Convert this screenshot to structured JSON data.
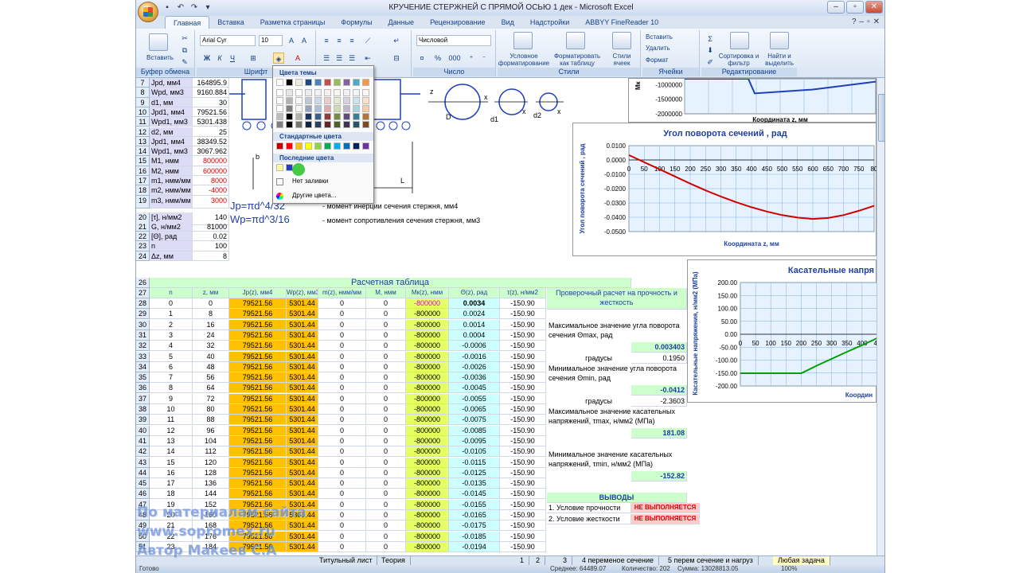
{
  "window": {
    "title": "КРУЧЕНИЕ СТЕРЖНЕЙ С ПРЯМОЙ ОСЬЮ 1 дек - Microsoft Excel"
  },
  "ribbon": {
    "tabs": [
      "Главная",
      "Вставка",
      "Разметка страницы",
      "Формулы",
      "Данные",
      "Рецензирование",
      "Вид",
      "Надстройки",
      "ABBYY FineReader 10"
    ],
    "clipboard": {
      "paste": "Вставить",
      "label": "Буфер обмена"
    },
    "font": {
      "name": "Arial Cyr",
      "size": "10",
      "label": "Шрифт",
      "bold": "Ж",
      "italic": "К",
      "underline": "Ч"
    },
    "number": {
      "format": "Числовой",
      "label": "Число",
      "percent": "%",
      "thousands": "000"
    },
    "styles": {
      "cond": "Условное форматирование",
      "table": "Форматировать как таблицу",
      "cell": "Стили ячеек",
      "label": "Стили"
    },
    "cells": {
      "insert": "Вставить",
      "delete": "Удалить",
      "format": "Формат",
      "label": "Ячейки"
    },
    "editing": {
      "sum": "Σ",
      "sort": "Сортировка и фильтр",
      "find": "Найти и выделить",
      "label": "Редактирование"
    }
  },
  "colorpop": {
    "theme_header": "Цвета темы",
    "standard_header": "Стандартные цвета",
    "recent_header": "Последние цвета",
    "no_fill": "Нет заливки",
    "more_colors": "Другие цвета...",
    "theme_top": [
      "#ffffff",
      "#000000",
      "#eeece1",
      "#1f497d",
      "#4f81bd",
      "#c0504d",
      "#9bbb59",
      "#8064a2",
      "#4bacc6",
      "#f79646"
    ],
    "standard": [
      "#c00000",
      "#ff0000",
      "#ffc000",
      "#ffff00",
      "#92d050",
      "#00b050",
      "#00b0f0",
      "#0070c0",
      "#002060",
      "#7030a0"
    ],
    "recent": [
      "#ffff99",
      "#1f3fbf"
    ]
  },
  "params": [
    {
      "row": "7",
      "name": "Jpd, мм4",
      "value": "164895.9"
    },
    {
      "row": "8",
      "name": "Wpd, мм3",
      "value": "9160.884"
    },
    {
      "row": "9",
      "name": "d1, мм",
      "value": "30"
    },
    {
      "row": "10",
      "name": "Jpd1, мм4",
      "value": "79521.56"
    },
    {
      "row": "11",
      "name": "Wpd1, мм3",
      "value": "5301.438"
    },
    {
      "row": "12",
      "name": "d2, мм",
      "value": "25"
    },
    {
      "row": "13",
      "name": "Jpd1, мм4",
      "value": "38349.52"
    },
    {
      "row": "14",
      "name": "Wpd1, мм3",
      "value": "3067.962"
    },
    {
      "row": "15",
      "name": "M1, нмм",
      "value": "800000"
    },
    {
      "row": "16",
      "name": "M2, нмм",
      "value": "600000"
    },
    {
      "row": "17",
      "name": "m1, нмм/мм",
      "value": "8000"
    },
    {
      "row": "18",
      "name": "m2, нмм/мм",
      "value": "-4000"
    },
    {
      "row": "19",
      "name": "m3, нмм/мм",
      "value": "3000"
    },
    {
      "row": "20",
      "name": "[τ], н/мм2",
      "value": "140"
    },
    {
      "row": "21",
      "name": "G, н/мм2",
      "value": "81000"
    },
    {
      "row": "22",
      "name": "[Θ], рад",
      "value": "0.02"
    },
    {
      "row": "23",
      "name": "n",
      "value": "100"
    },
    {
      "row": "24",
      "name": "Δz, мм",
      "value": "8"
    }
  ],
  "formulas": {
    "jp": "Jp=πd^4/32",
    "jp_desc": "- момент инерции сечения стержня, мм4",
    "wp": "Wp=πd^3/16",
    "wp_desc": "- момент сопротивления сечения стержня, мм3"
  },
  "diagram": {
    "labels": [
      "z",
      "D",
      "x",
      "d1",
      "x",
      "d2",
      "x",
      "L",
      "b"
    ]
  },
  "table": {
    "title": "Расчетная таблица",
    "title_row": "26",
    "header_row": "27",
    "headers": [
      "n",
      "z, мм",
      "Jp(z), мм4",
      "Wp(z), мм3",
      "m(z), нмм/мм",
      "M, нмм",
      "Mк(z), нмм",
      "Θ(z), рад",
      "τ(z), н/мм2"
    ],
    "rows": [
      [
        "28",
        "0",
        "0",
        "79521.56",
        "5301.44",
        "0",
        "0",
        "-800000",
        "0.0034",
        "-150.90"
      ],
      [
        "29",
        "1",
        "8",
        "79521.56",
        "5301.44",
        "0",
        "0",
        "-800000",
        "0.0024",
        "-150.90"
      ],
      [
        "30",
        "2",
        "16",
        "79521.56",
        "5301.44",
        "0",
        "0",
        "-800000",
        "0.0014",
        "-150.90"
      ],
      [
        "31",
        "3",
        "24",
        "79521.56",
        "5301.44",
        "0",
        "0",
        "-800000",
        "0.0004",
        "-150.90"
      ],
      [
        "32",
        "4",
        "32",
        "79521.56",
        "5301.44",
        "0",
        "0",
        "-800000",
        "-0.0006",
        "-150.90"
      ],
      [
        "33",
        "5",
        "40",
        "79521.56",
        "5301.44",
        "0",
        "0",
        "-800000",
        "-0.0016",
        "-150.90"
      ],
      [
        "34",
        "6",
        "48",
        "79521.56",
        "5301.44",
        "0",
        "0",
        "-800000",
        "-0.0026",
        "-150.90"
      ],
      [
        "35",
        "7",
        "56",
        "79521.56",
        "5301.44",
        "0",
        "0",
        "-800000",
        "-0.0036",
        "-150.90"
      ],
      [
        "36",
        "8",
        "64",
        "79521.56",
        "5301.44",
        "0",
        "0",
        "-800000",
        "-0.0045",
        "-150.90"
      ],
      [
        "37",
        "9",
        "72",
        "79521.56",
        "5301.44",
        "0",
        "0",
        "-800000",
        "-0.0055",
        "-150.90"
      ],
      [
        "38",
        "10",
        "80",
        "79521.56",
        "5301.44",
        "0",
        "0",
        "-800000",
        "-0.0065",
        "-150.90"
      ],
      [
        "39",
        "11",
        "88",
        "79521.56",
        "5301.44",
        "0",
        "0",
        "-800000",
        "-0.0075",
        "-150.90"
      ],
      [
        "40",
        "12",
        "96",
        "79521.56",
        "5301.44",
        "0",
        "0",
        "-800000",
        "-0.0085",
        "-150.90"
      ],
      [
        "41",
        "13",
        "104",
        "79521.56",
        "5301.44",
        "0",
        "0",
        "-800000",
        "-0.0095",
        "-150.90"
      ],
      [
        "42",
        "14",
        "112",
        "79521.56",
        "5301.44",
        "0",
        "0",
        "-800000",
        "-0.0105",
        "-150.90"
      ],
      [
        "43",
        "15",
        "120",
        "79521.56",
        "5301.44",
        "0",
        "0",
        "-800000",
        "-0.0115",
        "-150.90"
      ],
      [
        "44",
        "16",
        "128",
        "79521.56",
        "5301.44",
        "0",
        "0",
        "-800000",
        "-0.0125",
        "-150.90"
      ],
      [
        "45",
        "17",
        "136",
        "79521.56",
        "5301.44",
        "0",
        "0",
        "-800000",
        "-0.0135",
        "-150.90"
      ],
      [
        "46",
        "18",
        "144",
        "79521.56",
        "5301.44",
        "0",
        "0",
        "-800000",
        "-0.0145",
        "-150.90"
      ],
      [
        "47",
        "19",
        "152",
        "79521.56",
        "5301.44",
        "0",
        "0",
        "-800000",
        "-0.0155",
        "-150.90"
      ],
      [
        "48",
        "20",
        "160",
        "79521.56",
        "5301.44",
        "0",
        "0",
        "-800000",
        "-0.0165",
        "-150.90"
      ],
      [
        "49",
        "21",
        "168",
        "79521.56",
        "5301.44",
        "0",
        "0",
        "-800000",
        "-0.0175",
        "-150.90"
      ],
      [
        "50",
        "22",
        "176",
        "79521.56",
        "5301.44",
        "0",
        "0",
        "-800000",
        "-0.0185",
        "-150.90"
      ],
      [
        "51",
        "23",
        "184",
        "79521.56",
        "5301.44",
        "0",
        "0",
        "-800000",
        "-0.0194",
        "-150.90"
      ]
    ]
  },
  "check": {
    "title": "Проверочный расчет на прочность и жесткость",
    "max_angle_label": "Максимальное значение угла поворота сечения Θmax, рад",
    "max_angle": "0.003403",
    "deg_label": "градусы",
    "max_deg": "0.1950",
    "min_angle_label": "Минимальное значение угла поворота сечения Θmin, рад",
    "min_angle": "-0.0412",
    "min_deg": "-2.3603",
    "max_tau_label": "Максимальное значение касательных напряжений, τmax, н/мм2 (МПа)",
    "max_tau": "181.08",
    "min_tau_label": "Минимальное значение касательных напряжений, τmin, н/мм2 (МПа)",
    "min_tau": "-152.82",
    "conclusions": "ВЫВОДЫ",
    "strength_label": "1. Условие прочности",
    "strength_value": "НЕ ВЫПОЛНЯЕТСЯ",
    "stiffness_label": "2. Условие жесткости",
    "stiffness_value": "НЕ ВЫПОЛНЯЕТСЯ"
  },
  "sheet_tabs": [
    "Титульный лист",
    "Теория",
    "1",
    "2",
    "3",
    "4 переменое сечение",
    "5 перем сечение и нагруз",
    "Любая задача"
  ],
  "status": {
    "left": "Готово",
    "avg": "Среднее: 64489.07",
    "count": "Количество: 202",
    "sum": "Сумма: 13028813.05",
    "zoom": "100%"
  },
  "watermark": [
    "По материалам сайта",
    "www.sopromex.ru",
    "Автор Макеев С.А"
  ],
  "chart_data": [
    {
      "type": "line",
      "title": "",
      "ylabel": "Мк",
      "xlabel": "Координата z, мм",
      "y_ticks": [
        "-1000000",
        "-1500000",
        "-2000000"
      ],
      "ylim": [
        -2000000,
        -800000
      ],
      "x": [
        0,
        60,
        100,
        110,
        200,
        300
      ],
      "series": [
        {
          "values": [
            -800000,
            -800000,
            -800000,
            -1300000,
            -1170000,
            -900000
          ],
          "color": "#1f3fbf"
        }
      ]
    },
    {
      "type": "line",
      "title": "Угол поворота сечений , рад",
      "ylabel": "Угол поворота сечений , рад",
      "xlabel": "Координата z, мм",
      "x_ticks": [
        "0",
        "50",
        "100",
        "150",
        "200",
        "250",
        "300",
        "350",
        "400",
        "450",
        "500",
        "550",
        "600",
        "650",
        "700",
        "750",
        "80"
      ],
      "y_ticks": [
        "0.0100",
        "0.0000",
        "-0.0100",
        "-0.0200",
        "-0.0300",
        "-0.0400",
        "-0.0500"
      ],
      "xlim": [
        0,
        800
      ],
      "ylim": [
        -0.05,
        0.01
      ],
      "x": [
        0,
        50,
        100,
        150,
        200,
        250,
        300,
        350,
        400,
        450,
        500,
        550,
        600,
        650,
        700,
        750,
        800
      ],
      "series": [
        {
          "values": [
            0.0034,
            -0.0016,
            -0.0065,
            -0.0115,
            -0.0165,
            -0.0212,
            -0.0255,
            -0.0295,
            -0.033,
            -0.036,
            -0.0385,
            -0.0402,
            -0.0412,
            -0.0405,
            -0.0385,
            -0.0355,
            -0.032
          ],
          "color": "#d00000"
        }
      ]
    },
    {
      "type": "line",
      "title": "Касательные напря",
      "ylabel": "Касательные напряжения, н/мм2 (МПа)",
      "xlabel": "Координ",
      "x_ticks": [
        "0",
        "50",
        "100",
        "150",
        "200",
        "250",
        "300",
        "350",
        "400",
        "45"
      ],
      "y_ticks": [
        "200.00",
        "150.00",
        "100.00",
        "50.00",
        "0.00",
        "-50.00",
        "-100.00",
        "-150.00",
        "-200.00"
      ],
      "xlim": [
        0,
        450
      ],
      "ylim": [
        -200,
        200
      ],
      "x": [
        0,
        50,
        100,
        150,
        200,
        250,
        300,
        350,
        400,
        450
      ],
      "series": [
        {
          "values": [
            -150.9,
            -150.9,
            -150.9,
            -150.9,
            -150.9,
            -122,
            -95,
            -68,
            -42,
            -15
          ],
          "color": "#00a000"
        }
      ]
    }
  ]
}
